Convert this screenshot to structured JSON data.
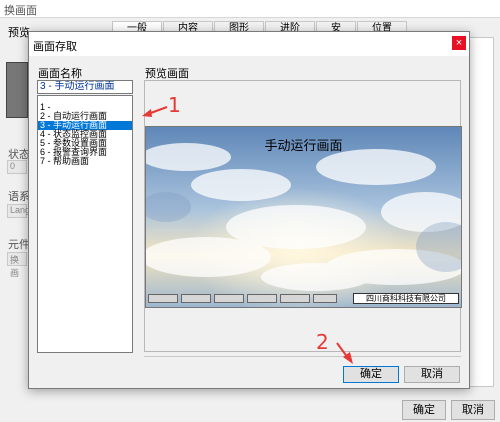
{
  "background_window": {
    "title": "换画面",
    "preview_label": "预览",
    "tabs": [
      "一般",
      "内容",
      "图形",
      "进阶",
      "安",
      "位置"
    ],
    "side_labels": [
      "状态",
      "语系",
      "元件"
    ],
    "side_fields": [
      "0",
      "Lang",
      "换画"
    ],
    "ok_label": "确定",
    "cancel_label": "取消"
  },
  "dialog": {
    "title": "画面存取",
    "close_label": "×",
    "names_label": "画面名称",
    "preview_label": "预览画面",
    "combo_value": "3 - 手动运行画面",
    "list_items": [
      "1 -",
      "2 - 自动运行画面",
      "3 - 手动运行画面",
      "4 - 状态监控画面",
      "5 - 参数设置画面",
      "6 - 报警查询界面",
      "7 - 帮助画面"
    ],
    "selected_index": 2,
    "preview": {
      "title": "手动运行画面",
      "buttons": [
        "",
        "",
        "",
        "",
        "",
        ""
      ],
      "company": "四川商科科技有限公司"
    },
    "ok_label": "确定",
    "cancel_label": "取消"
  },
  "annotations": {
    "label_1": "1",
    "label_2": "2",
    "color": "#e53935"
  },
  "colors": {
    "selection": "#0078d7",
    "close_button": "#e81123"
  }
}
